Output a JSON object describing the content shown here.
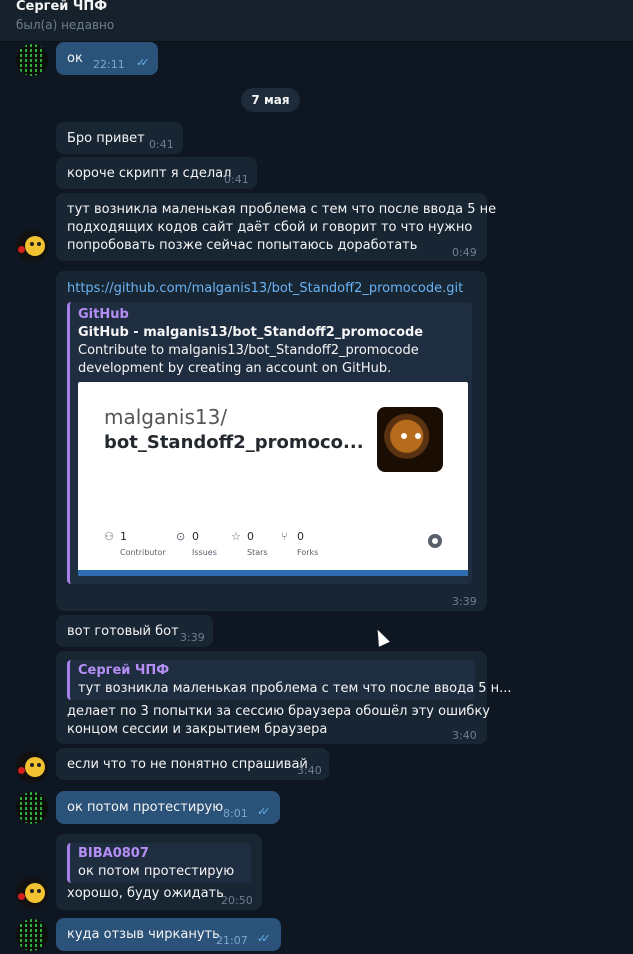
{
  "header": {
    "name": "Сергей ЧПФ",
    "status": "был(а) недавно"
  },
  "date_separator": "7 мая",
  "messages": {
    "m1": {
      "text": "ок",
      "time": "22:11"
    },
    "m2": {
      "text": "Бро привет",
      "time": "0:41"
    },
    "m3": {
      "text": "короче скрипт я сделал",
      "time": "0:41"
    },
    "m4": {
      "text": "тут возникла маленькая проблема с тем что после ввода 5 не\nподходящих кодов сайт даёт сбой и говорит то что нужно\nпопробовать позже сейчас попытаюсь доработать",
      "time": "0:49"
    },
    "m5": {
      "link": "https://github.com/malganis13/bot_Standoff2_promocode.git",
      "time": "3:39",
      "preview": {
        "site": "GitHub",
        "title": "GitHub - malganis13/bot_Standoff2_promocode",
        "description": "Contribute to malganis13/bot_Standoff2_promocode\ndevelopment by creating an account on GitHub.",
        "card_owner": "malganis13/",
        "card_repo": "bot_Standoff2_promoco...",
        "stats": [
          {
            "value": "1",
            "label": "Contributor"
          },
          {
            "value": "0",
            "label": "Issues"
          },
          {
            "value": "0",
            "label": "Stars"
          },
          {
            "value": "0",
            "label": "Forks"
          }
        ]
      }
    },
    "m6": {
      "text": "вот готовый бот",
      "time": "3:39"
    },
    "m7": {
      "reply_name": "Сергей ЧПФ",
      "reply_text": "тут возникла маленькая проблема с тем что после ввода 5 н...",
      "text": "делает по 3 попытки за сессию браузера обошёл эту ошибку\nконцом сессии и закрытием браузера",
      "time": "3:40"
    },
    "m8": {
      "text": "если что то не понятно спрашивай",
      "time": "3:40"
    },
    "m9": {
      "text": "ок потом протестирую",
      "time": "8:01"
    },
    "m10": {
      "reply_name": "BIBA0807",
      "reply_text": "ок потом протестирую",
      "text": "хорошо, буду ожидать",
      "time": "20:50"
    },
    "m11": {
      "text": "куда отзыв чиркануть",
      "time": "21:07"
    }
  },
  "icons": {
    "read_receipt": "double-check-icon",
    "stat_icons": [
      "people-icon",
      "issue-icon",
      "star-icon",
      "fork-icon"
    ]
  },
  "colors": {
    "background": "#0e1621",
    "incoming_bubble": "#182533",
    "outgoing_bubble": "#2b5278",
    "link": "#6ab3f3",
    "accent_name": "#b58ff5"
  }
}
